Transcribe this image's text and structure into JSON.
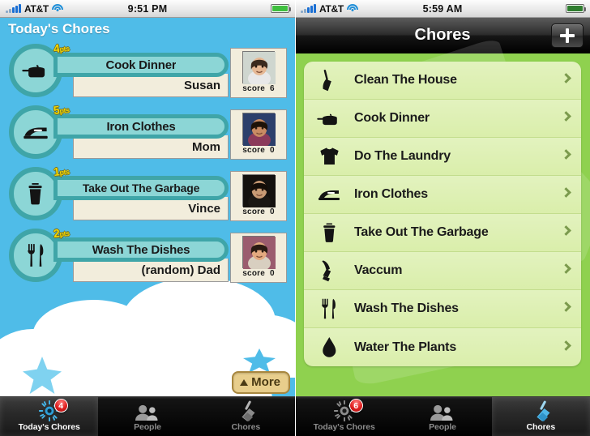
{
  "left": {
    "status": {
      "carrier": "AT&T",
      "time": "9:51 PM",
      "signal_icon": "signal-bars-icon",
      "wifi_icon": "wifi-icon",
      "battery_icon": "battery-full-icon",
      "battery_color": "#3fbf3f"
    },
    "header": {
      "title": "Today's Chores"
    },
    "rows": [
      {
        "points": "4",
        "points_unit": "pts",
        "chore": "Cook Dinner",
        "person": "Susan",
        "score_label": "score",
        "score_value": "6",
        "icon": "pot-icon",
        "avatar": "photo-susan"
      },
      {
        "points": "5",
        "points_unit": "pts",
        "chore": "Iron Clothes",
        "person": "Mom",
        "score_label": "score",
        "score_value": "0",
        "icon": "iron-icon",
        "avatar": "photo-mom"
      },
      {
        "points": "1",
        "points_unit": "pts",
        "chore": "Take Out The Garbage",
        "person": "Vince",
        "score_label": "score",
        "score_value": "0",
        "icon": "trash-can-icon",
        "avatar": "photo-vince"
      },
      {
        "points": "2",
        "points_unit": "pts",
        "chore": "Wash The Dishes",
        "person": "(random) Dad",
        "score_label": "score",
        "score_value": "0",
        "icon": "fork-knife-icon",
        "avatar": "photo-dad"
      }
    ],
    "more_button": {
      "label": "More",
      "arrow_icon": "triangle-up-icon"
    },
    "tabs": [
      {
        "label": "Today's Chores",
        "icon": "sun-gear-icon",
        "active": true,
        "badge": "4"
      },
      {
        "label": "People",
        "icon": "people-icon",
        "active": false,
        "badge": ""
      },
      {
        "label": "Chores",
        "icon": "broom-icon",
        "active": false,
        "badge": ""
      }
    ]
  },
  "right": {
    "status": {
      "carrier": "AT&T",
      "time": "5:59 AM",
      "signal_icon": "signal-bars-icon",
      "wifi_icon": "wifi-icon",
      "battery_icon": "battery-charging-icon",
      "battery_color": "#2f7d2f"
    },
    "navbar": {
      "title": "Chores",
      "add_label": "+",
      "add_icon": "plus-icon"
    },
    "list": [
      {
        "label": "Clean The House",
        "icon": "broom-icon",
        "chevron": "chevron-right-icon"
      },
      {
        "label": "Cook Dinner",
        "icon": "pot-icon",
        "chevron": "chevron-right-icon"
      },
      {
        "label": "Do The Laundry",
        "icon": "tshirt-icon",
        "chevron": "chevron-right-icon"
      },
      {
        "label": "Iron Clothes",
        "icon": "iron-icon",
        "chevron": "chevron-right-icon"
      },
      {
        "label": "Take Out The Garbage",
        "icon": "trash-can-icon",
        "chevron": "chevron-right-icon"
      },
      {
        "label": "Vaccum",
        "icon": "vacuum-icon",
        "chevron": "chevron-right-icon"
      },
      {
        "label": "Wash The Dishes",
        "icon": "fork-knife-icon",
        "chevron": "chevron-right-icon"
      },
      {
        "label": "Water The Plants",
        "icon": "water-drop-icon",
        "chevron": "chevron-right-icon"
      }
    ],
    "tabs": [
      {
        "label": "Today's Chores",
        "icon": "sun-gear-icon",
        "active": false,
        "badge": "6"
      },
      {
        "label": "People",
        "icon": "people-icon",
        "active": false,
        "badge": ""
      },
      {
        "label": "Chores",
        "icon": "broom-icon",
        "active": true,
        "badge": ""
      }
    ]
  },
  "colors": {
    "sky": "#4FBCE8",
    "teal_fill": "#8CD6D6",
    "teal_border": "#3FA5A8",
    "cream": "#F2EDDC",
    "points_yellow": "#F5D800",
    "green_bg": "#8FD14F",
    "cell_green": "#D9EEA9",
    "badge_red": "#e02020"
  }
}
